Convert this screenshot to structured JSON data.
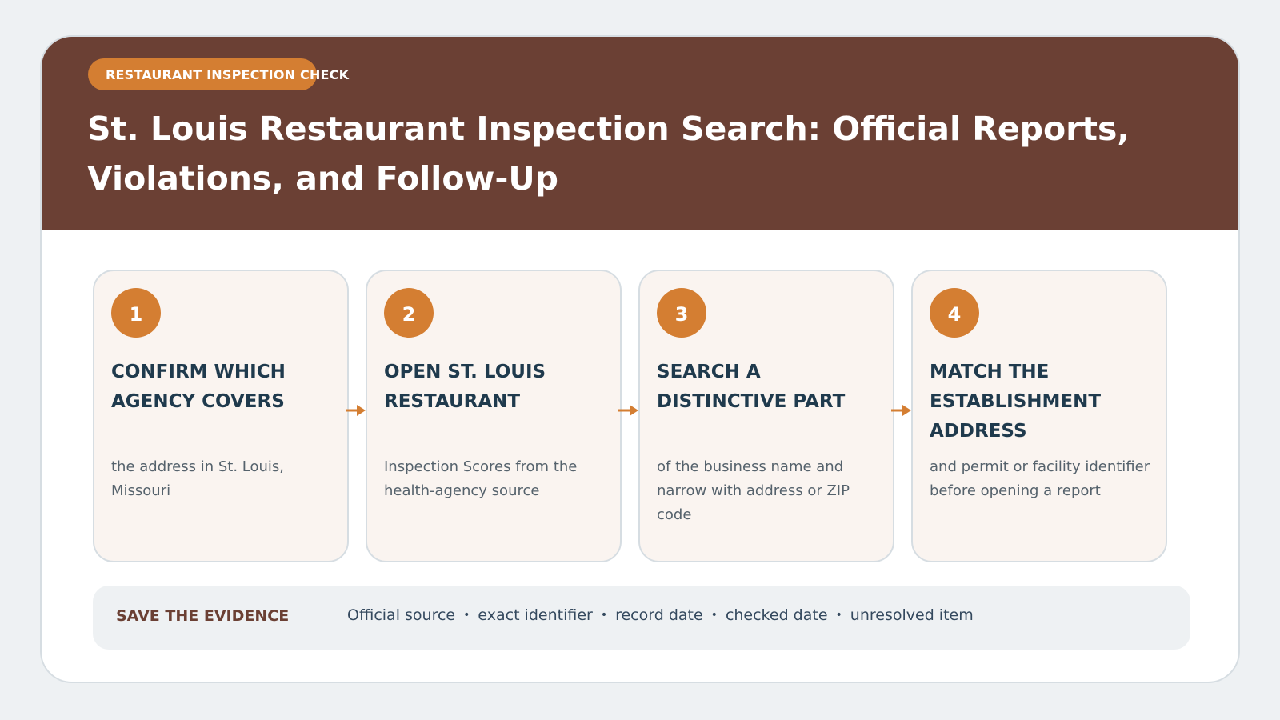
{
  "header": {
    "badge_label": "RESTAURANT INSPECTION CHECK",
    "title": "St. Louis Restaurant Inspection Search: Official Reports, Violations, and Follow-Up"
  },
  "steps": [
    {
      "number": "1",
      "title": "CONFIRM WHICH AGENCY COVERS",
      "description": "the address in St. Louis, Missouri"
    },
    {
      "number": "2",
      "title": "OPEN ST. LOUIS RESTAURANT",
      "description": "Inspection Scores from the health-agency source"
    },
    {
      "number": "3",
      "title": "SEARCH A DISTINCTIVE PART",
      "description": "of the business name and narrow with address or ZIP code"
    },
    {
      "number": "4",
      "title": "MATCH THE ESTABLISHMENT ADDRESS",
      "description": "and permit or facility identifier before opening a report"
    }
  ],
  "evidence": {
    "label": "SAVE THE EVIDENCE",
    "items": [
      "Official source",
      "exact identifier",
      "record date",
      "checked date",
      "unresolved item"
    ],
    "separator": "•"
  },
  "colors": {
    "header_bg": "#6b4034",
    "accent": "#d47e32",
    "step_title": "#1f3a4d"
  },
  "icons": {
    "connector": "right-arrow-icon"
  }
}
